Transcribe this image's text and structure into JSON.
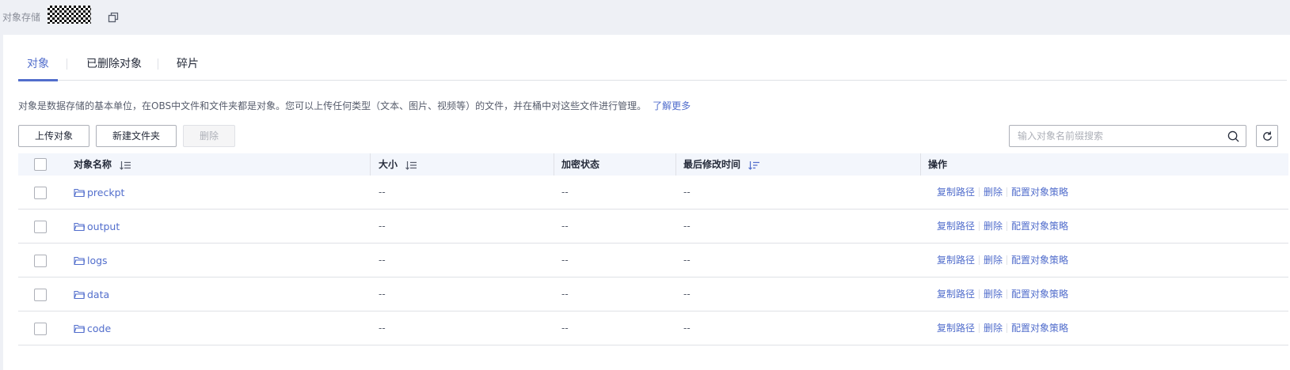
{
  "header": {
    "title": "对象存储",
    "bucket_name_masked": "",
    "copy_icon": "copy-icon"
  },
  "tabs": [
    {
      "label": "对象",
      "active": true
    },
    {
      "label": "已删除对象",
      "active": false
    },
    {
      "label": "碎片",
      "active": false
    }
  ],
  "description": {
    "text": "对象是数据存储的基本单位，在OBS中文件和文件夹都是对象。您可以上传任何类型（文本、图片、视频等）的文件，并在桶中对这些文件进行管理。",
    "link": "了解更多"
  },
  "toolbar": {
    "upload_label": "上传对象",
    "new_folder_label": "新建文件夹",
    "delete_label": "删除",
    "search_placeholder": "输入对象名前缀搜索"
  },
  "table": {
    "columns": {
      "name": "对象名称",
      "size": "大小",
      "encryption": "加密状态",
      "modified": "最后修改时间",
      "actions": "操作"
    },
    "rows": [
      {
        "name": "preckpt",
        "size": "--",
        "encryption": "--",
        "modified": "--"
      },
      {
        "name": "output",
        "size": "--",
        "encryption": "--",
        "modified": "--"
      },
      {
        "name": "logs",
        "size": "--",
        "encryption": "--",
        "modified": "--"
      },
      {
        "name": "data",
        "size": "--",
        "encryption": "--",
        "modified": "--"
      },
      {
        "name": "code",
        "size": "--",
        "encryption": "--",
        "modified": "--"
      }
    ],
    "row_actions": {
      "copy_path": "复制路径",
      "delete": "删除",
      "config_policy": "配置对象策略"
    }
  },
  "colors": {
    "accent": "#526ecc",
    "header_bg": "#f3f6fc",
    "page_bg": "#eef0f5"
  }
}
